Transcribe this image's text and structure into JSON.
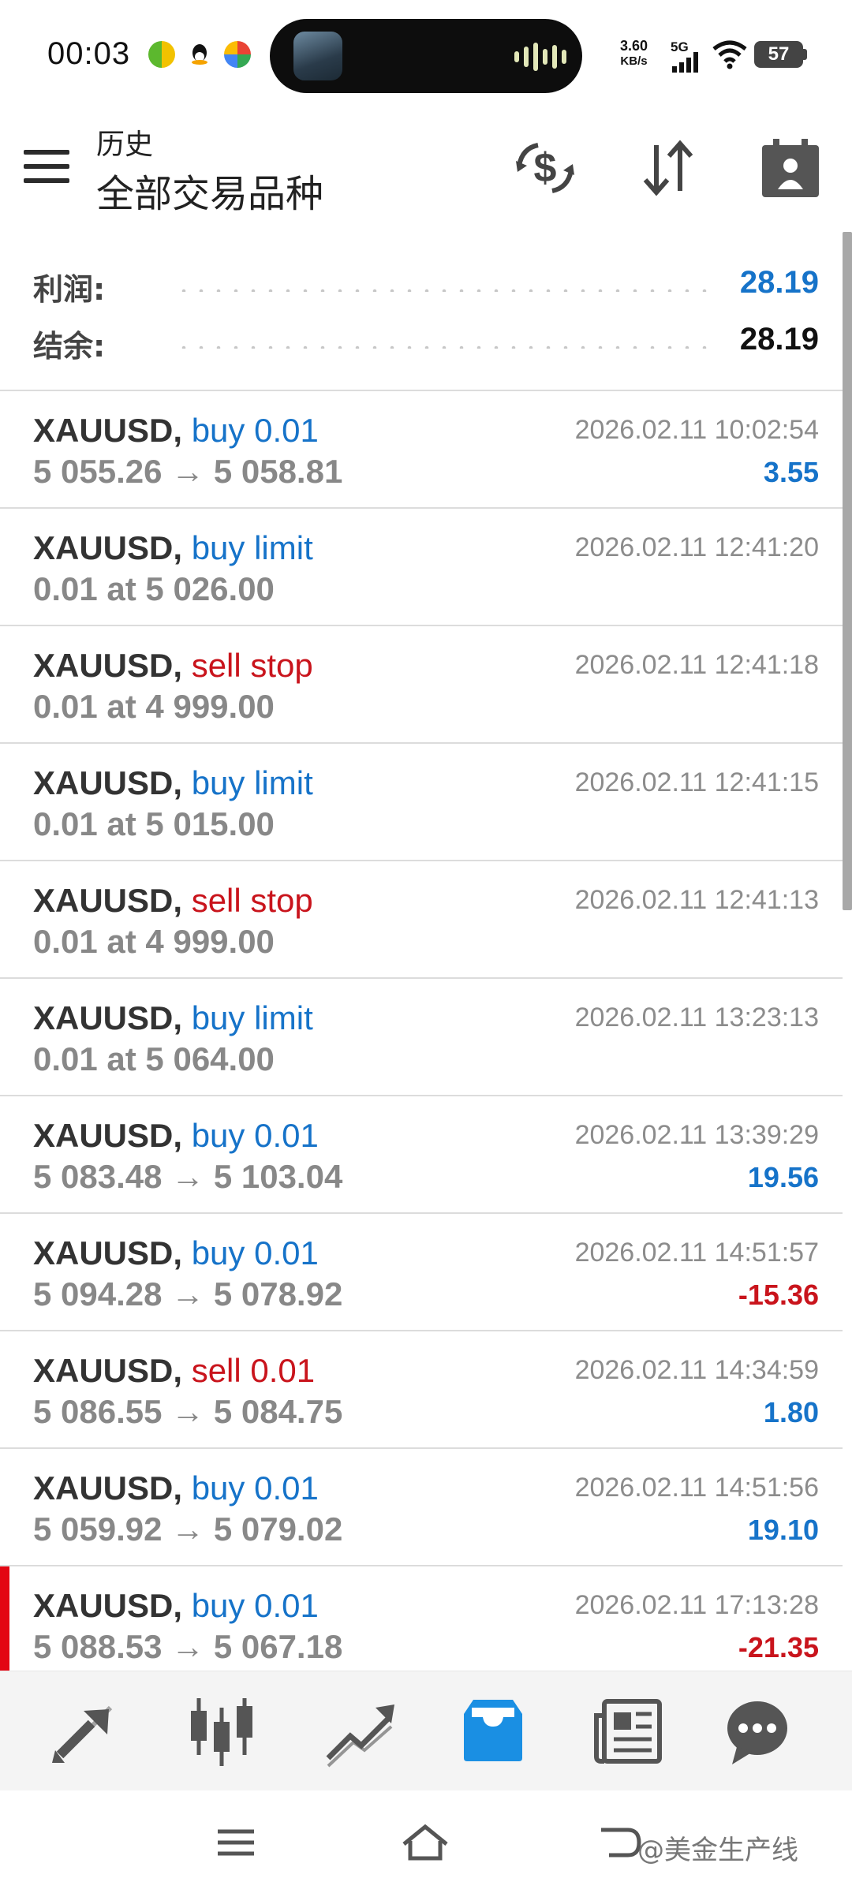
{
  "status_bar": {
    "time": "00:03",
    "net_speed_value": "3.60",
    "net_speed_unit": "KB/s",
    "network": "5G",
    "battery": "57"
  },
  "header": {
    "subtitle": "历史",
    "title": "全部交易品种",
    "icons": [
      "currency-exchange-icon",
      "sort-icon",
      "calendar-icon"
    ]
  },
  "summary": {
    "profit_label": "利润:",
    "profit_value": "28.19",
    "balance_label": "结余:",
    "balance_value": "28.19",
    "colors": {
      "profit": "#1673c9",
      "balance": "#111111"
    }
  },
  "trades": [
    {
      "symbol": "XAUUSD,",
      "action": "buy 0.01",
      "action_color": "blue",
      "detail": "5 055.26 → 5 058.81",
      "time": "2026.02.11 10:02:54",
      "profit": "3.55",
      "profit_color": "blue"
    },
    {
      "symbol": "XAUUSD,",
      "action": "buy limit",
      "action_color": "blue",
      "detail": "0.01 at 5 026.00",
      "time": "2026.02.11 12:41:20",
      "profit": "",
      "profit_color": "blue"
    },
    {
      "symbol": "XAUUSD,",
      "action": "sell stop",
      "action_color": "red",
      "detail": "0.01 at 4 999.00",
      "time": "2026.02.11 12:41:18",
      "profit": "",
      "profit_color": "blue"
    },
    {
      "symbol": "XAUUSD,",
      "action": "buy limit",
      "action_color": "blue",
      "detail": "0.01 at 5 015.00",
      "time": "2026.02.11 12:41:15",
      "profit": "",
      "profit_color": "blue"
    },
    {
      "symbol": "XAUUSD,",
      "action": "sell stop",
      "action_color": "red",
      "detail": "0.01 at 4 999.00",
      "time": "2026.02.11 12:41:13",
      "profit": "",
      "profit_color": "blue"
    },
    {
      "symbol": "XAUUSD,",
      "action": "buy limit",
      "action_color": "blue",
      "detail": "0.01 at 5 064.00",
      "time": "2026.02.11 13:23:13",
      "profit": "",
      "profit_color": "blue"
    },
    {
      "symbol": "XAUUSD,",
      "action": "buy 0.01",
      "action_color": "blue",
      "detail": "5 083.48 → 5 103.04",
      "time": "2026.02.11 13:39:29",
      "profit": "19.56",
      "profit_color": "blue"
    },
    {
      "symbol": "XAUUSD,",
      "action": "buy 0.01",
      "action_color": "blue",
      "detail": "5 094.28 → 5 078.92",
      "time": "2026.02.11 14:51:57",
      "profit": "-15.36",
      "profit_color": "red"
    },
    {
      "symbol": "XAUUSD,",
      "action": "sell 0.01",
      "action_color": "red",
      "detail": "5 086.55 → 5 084.75",
      "time": "2026.02.11 14:34:59",
      "profit": "1.80",
      "profit_color": "blue"
    },
    {
      "symbol": "XAUUSD,",
      "action": "buy 0.01",
      "action_color": "blue",
      "detail": "5 059.92 → 5 079.02",
      "time": "2026.02.11 14:51:56",
      "profit": "19.10",
      "profit_color": "blue"
    },
    {
      "symbol": "XAUUSD,",
      "action": "buy 0.01",
      "action_color": "blue",
      "detail": "5 088.53 → 5 067.18",
      "time": "2026.02.11 17:13:28",
      "profit": "-21.35",
      "profit_color": "red",
      "marked": true
    }
  ],
  "tab_bar": {
    "tabs": [
      {
        "name": "quotes",
        "icon": "quotes-arrows-icon",
        "active": false
      },
      {
        "name": "chart",
        "icon": "candlestick-icon",
        "active": false
      },
      {
        "name": "trade",
        "icon": "trend-line-icon",
        "active": false
      },
      {
        "name": "history",
        "icon": "inbox-icon",
        "active": true
      },
      {
        "name": "news",
        "icon": "newspaper-icon",
        "active": false
      },
      {
        "name": "messages",
        "icon": "chat-bubble-icon",
        "active": false
      }
    ],
    "active_color": "#1a8fe3",
    "inactive_color": "#555555"
  },
  "nav_bar": {
    "watermark": "@美金生产线"
  }
}
